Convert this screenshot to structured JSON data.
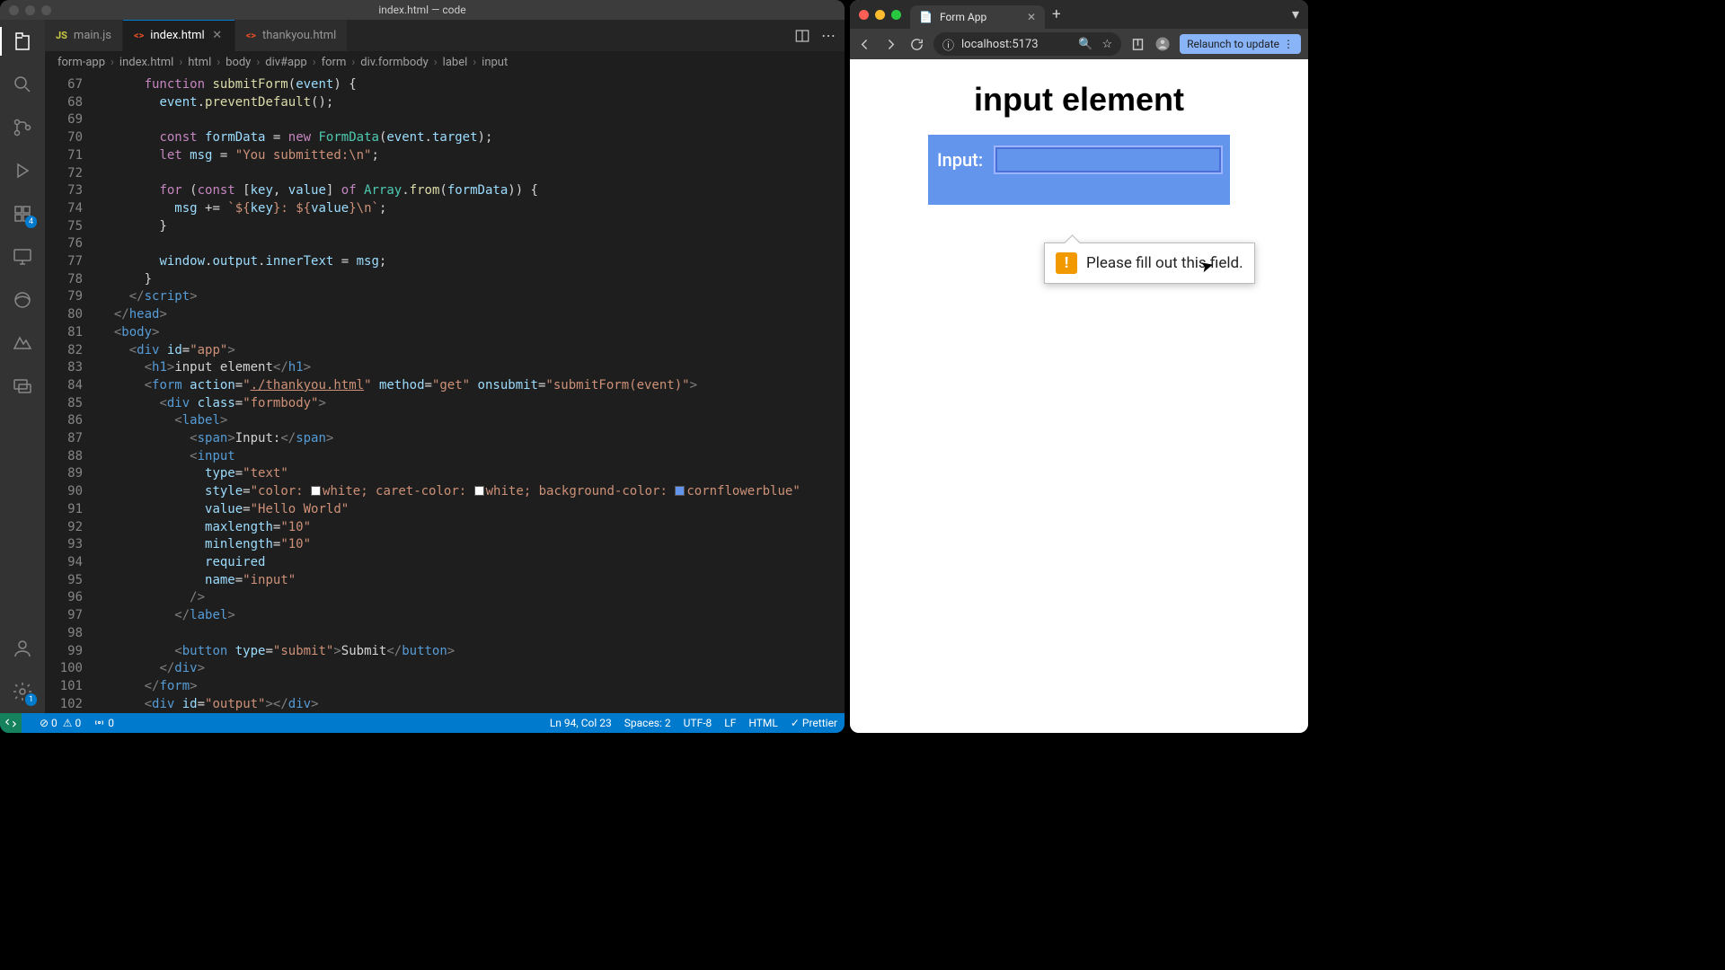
{
  "vscode": {
    "title": "index.html — code",
    "tabs": [
      {
        "label": "main.js",
        "iconClass": "js-icon",
        "iconText": "JS"
      },
      {
        "label": "index.html",
        "iconClass": "html-icon",
        "iconText": "<>"
      },
      {
        "label": "thankyou.html",
        "iconClass": "html-icon",
        "iconText": "<>"
      }
    ],
    "activeTab": 1,
    "breadcrumbs": [
      "form-app",
      "index.html",
      "html",
      "body",
      "div#app",
      "form",
      "div.formbody",
      "label",
      "input"
    ],
    "activityBadge": "4",
    "settingsBadge": "1",
    "lines": [
      {
        "n": 67,
        "html": "      <span class='kc'>function</span> <span class='fn'>submitForm</span>(<span class='n'>event</span>) {"
      },
      {
        "n": 68,
        "html": "        <span class='n'>event</span>.<span class='fn'>preventDefault</span>();"
      },
      {
        "n": 69,
        "html": ""
      },
      {
        "n": 70,
        "html": "        <span class='kc'>const</span> <span class='n'>formData</span> = <span class='kc'>new</span> <span class='ty'>FormData</span>(<span class='n'>event</span>.<span class='n'>target</span>);"
      },
      {
        "n": 71,
        "html": "        <span class='kc'>let</span> <span class='n'>msg</span> = <span class='s'>\"You submitted:\\n\"</span>;"
      },
      {
        "n": 72,
        "html": ""
      },
      {
        "n": 73,
        "html": "        <span class='kc'>for</span> (<span class='kc'>const</span> [<span class='n'>key</span>, <span class='n'>value</span>] <span class='kc'>of</span> <span class='ty'>Array</span>.<span class='fn'>from</span>(<span class='n'>formData</span>)) {"
      },
      {
        "n": 74,
        "html": "          <span class='n'>msg</span> += <span class='s'>`${<span class='n'>key</span>}: ${<span class='n'>value</span>}\\n`</span>;"
      },
      {
        "n": 75,
        "html": "        }"
      },
      {
        "n": 76,
        "html": ""
      },
      {
        "n": 77,
        "html": "        <span class='n'>window</span>.<span class='n'>output</span>.<span class='n'>innerText</span> = <span class='n'>msg</span>;"
      },
      {
        "n": 78,
        "html": "      }"
      },
      {
        "n": 79,
        "html": "    <span class='t'>&lt;/</span><span class='tn'>script</span><span class='t'>&gt;</span>"
      },
      {
        "n": 80,
        "html": "  <span class='t'>&lt;/</span><span class='tn'>head</span><span class='t'>&gt;</span>"
      },
      {
        "n": 81,
        "html": "  <span class='t'>&lt;</span><span class='tn'>body</span><span class='t'>&gt;</span>"
      },
      {
        "n": 82,
        "html": "    <span class='t'>&lt;</span><span class='tn'>div</span> <span class='at'>id</span>=<span class='s'>\"app\"</span><span class='t'>&gt;</span>"
      },
      {
        "n": 83,
        "html": "      <span class='t'>&lt;</span><span class='tn'>h1</span><span class='t'>&gt;</span>input element<span class='t'>&lt;/</span><span class='tn'>h1</span><span class='t'>&gt;</span>"
      },
      {
        "n": 84,
        "html": "      <span class='t'>&lt;</span><span class='tn'>form</span> <span class='at'>action</span>=<span class='s'>\"<u>./thankyou.html</u>\"</span> <span class='at'>method</span>=<span class='s'>\"get\"</span> <span class='at'>onsubmit</span>=<span class='s'>\"submitForm(event)\"</span><span class='t'>&gt;</span>"
      },
      {
        "n": 85,
        "html": "        <span class='t'>&lt;</span><span class='tn'>div</span> <span class='at'>class</span>=<span class='s'>\"formbody\"</span><span class='t'>&gt;</span>"
      },
      {
        "n": 86,
        "html": "          <span class='t'>&lt;</span><span class='tn'>label</span><span class='t'>&gt;</span>"
      },
      {
        "n": 87,
        "html": "            <span class='t'>&lt;</span><span class='tn'>span</span><span class='t'>&gt;</span>Input:<span class='t'>&lt;/</span><span class='tn'>span</span><span class='t'>&gt;</span>"
      },
      {
        "n": 88,
        "html": "            <span class='t'>&lt;</span><span class='tn'>input</span>"
      },
      {
        "n": 89,
        "html": "              <span class='at'>type</span>=<span class='s'>\"text\"</span>"
      },
      {
        "n": 90,
        "html": "              <span class='at'>style</span>=<span class='s'>\"color: <span class='cswatch' style='background:#fff'></span>white; caret-color: <span class='cswatch' style='background:#fff'></span>white; background-color: <span class='cswatch' style='background:#6495ed'></span>cornflowerblue\"</span>"
      },
      {
        "n": 91,
        "html": "              <span class='at'>value</span>=<span class='s'>\"Hello World\"</span>"
      },
      {
        "n": 92,
        "html": "              <span class='at'>maxlength</span>=<span class='s'>\"10\"</span>"
      },
      {
        "n": 93,
        "html": "              <span class='at'>minlength</span>=<span class='s'>\"10\"</span>"
      },
      {
        "n": 94,
        "html": "              <span class='at'>required</span>"
      },
      {
        "n": 95,
        "html": "              <span class='at'>name</span>=<span class='s'>\"input\"</span>"
      },
      {
        "n": 96,
        "html": "            <span class='t'>/&gt;</span>"
      },
      {
        "n": 97,
        "html": "          <span class='t'>&lt;/</span><span class='tn'>label</span><span class='t'>&gt;</span>"
      },
      {
        "n": 98,
        "html": ""
      },
      {
        "n": 99,
        "html": "          <span class='t'>&lt;</span><span class='tn'>button</span> <span class='at'>type</span>=<span class='s'>\"submit\"</span><span class='t'>&gt;</span>Submit<span class='t'>&lt;/</span><span class='tn'>button</span><span class='t'>&gt;</span>"
      },
      {
        "n": 100,
        "html": "        <span class='t'>&lt;/</span><span class='tn'>div</span><span class='t'>&gt;</span>"
      },
      {
        "n": 101,
        "html": "      <span class='t'>&lt;/</span><span class='tn'>form</span><span class='t'>&gt;</span>"
      },
      {
        "n": 102,
        "html": "      <span class='t'>&lt;</span><span class='tn'>div</span> <span class='at'>id</span>=<span class='s'>\"output\"</span><span class='t'>&gt;&lt;/</span><span class='tn'>div</span><span class='t'>&gt;</span>"
      }
    ],
    "status": {
      "errors": "0",
      "warnings": "0",
      "ports": "0",
      "cursor": "Ln 94, Col 23",
      "spaces": "Spaces: 2",
      "encoding": "UTF-8",
      "eol": "LF",
      "lang": "HTML",
      "formatter": "Prettier"
    }
  },
  "browser": {
    "tabTitle": "Form App",
    "url": "localhost:5173",
    "relaunch": "Relaunch to update",
    "pageHeading": "input element",
    "inputLabel": "Input:",
    "inputValue": "",
    "validationMsg": "Please fill out this field.",
    "validationIcon": "!"
  }
}
